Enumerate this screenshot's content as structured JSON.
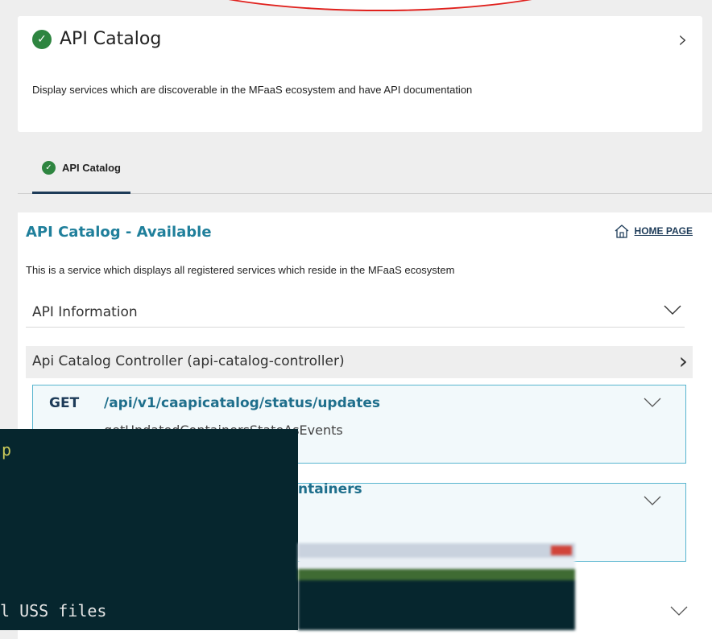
{
  "service_card": {
    "title": "API Catalog",
    "description": "Display services which are discoverable in the MFaaS ecosystem and have API documentation"
  },
  "tabs": [
    {
      "label": "API Catalog",
      "active": true
    }
  ],
  "service_detail": {
    "title": "API Catalog - Available",
    "home_page_label": "HOME PAGE",
    "description": "This is a service which displays all registered services which reside in the MFaaS ecosystem",
    "api_information_label": "API Information",
    "controller_label": "Api Catalog Controller (api-catalog-controller)",
    "operations": [
      {
        "method": "GET",
        "path": "/api/v1/caapicatalog/status/updates",
        "summary": "getUpdatedContainersStateAsEvents"
      },
      {
        "method": "",
        "path": "ntainers",
        "summary": ""
      }
    ]
  },
  "terminal": {
    "line1": "p",
    "line2": "l USS files"
  },
  "colors": {
    "accent_teal": "#1f7f9b",
    "status_green": "#2e8540",
    "terminal_bg": "#06262e",
    "annotation_red": "#e0211d"
  },
  "icons": [
    "check-circle-icon",
    "chevron-right-icon",
    "chevron-down-icon",
    "home-icon"
  ]
}
